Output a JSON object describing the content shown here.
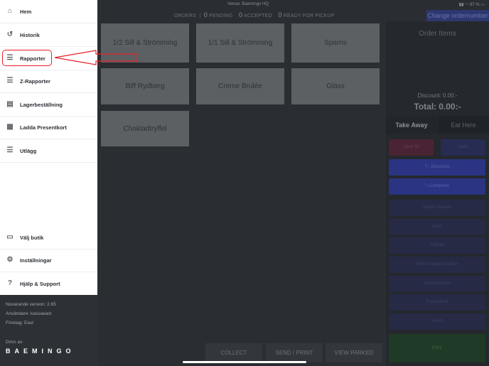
{
  "status": {
    "venue": "Venue: Baemingo HQ",
    "battery": "87 %"
  },
  "orders": {
    "label": "ORDERS",
    "pending_count": "0",
    "pending": "PENDING",
    "accepted_count": "0",
    "accepted": "ACCEPTED",
    "ready_count": "0",
    "ready": "READY FOR PICKUP"
  },
  "change_ordernumber": "Change ordernumber",
  "products": [
    "1/2 Sill & Strömming",
    "1/1 Sill & Strömming",
    "Sparris",
    "Biff Rydberg",
    "Creme Brulée",
    "Glass",
    "Chokladtryffel"
  ],
  "order": {
    "title": "Order Items",
    "discount": "Discount: 0.00:-",
    "total_label": "Total:",
    "total": "0.00:-"
  },
  "tabs": [
    "Take Away",
    "Eat Here"
  ],
  "actions": {
    "clear": "Clear All",
    "undo": "Undo",
    "discounts": "Discounts",
    "comprime": "Comprime"
  },
  "payments": [
    "Adyen Manuell",
    "Card",
    "Faktura",
    "Intern Representation",
    "Lunchklubben",
    "Presentkort",
    "Swish"
  ],
  "pay": "PAY",
  "bottom": [
    "COLLECT",
    "SEND / PRINT",
    "VIEW PARKED"
  ],
  "sidebar": {
    "items": [
      {
        "label": "Hem",
        "icon": "home-icon",
        "glyph": "⌂"
      },
      {
        "label": "Historik",
        "icon": "history-icon",
        "glyph": "↺"
      },
      {
        "label": "Rapporter",
        "icon": "list-icon",
        "glyph": "☰"
      },
      {
        "label": "Z-Rapporter",
        "icon": "list-icon",
        "glyph": "☰"
      },
      {
        "label": "Lagerbeställning",
        "icon": "inventory-icon",
        "glyph": "▤"
      },
      {
        "label": "Ladda Presentkort",
        "icon": "calendar-icon",
        "glyph": "▦"
      },
      {
        "label": "Utlägg",
        "icon": "list-icon",
        "glyph": "☰"
      },
      {
        "label": "Välj butik",
        "icon": "store-icon",
        "glyph": "▭"
      },
      {
        "label": "Inställningar",
        "icon": "gear-icon",
        "glyph": "⚙"
      },
      {
        "label": "Hjälp & Support",
        "icon": "help-icon",
        "glyph": "?"
      }
    ]
  },
  "footer": {
    "version": "Nuvarande version: 2.65",
    "user": "Användare: kassaeast",
    "company": "Företag: East",
    "powered": "Drivs av",
    "brand": "BAEMINGO"
  },
  "colors": {
    "annotation": "#e8202a",
    "pay": "#1f3a26",
    "clear": "#4a2434",
    "action": "#2a3482"
  }
}
